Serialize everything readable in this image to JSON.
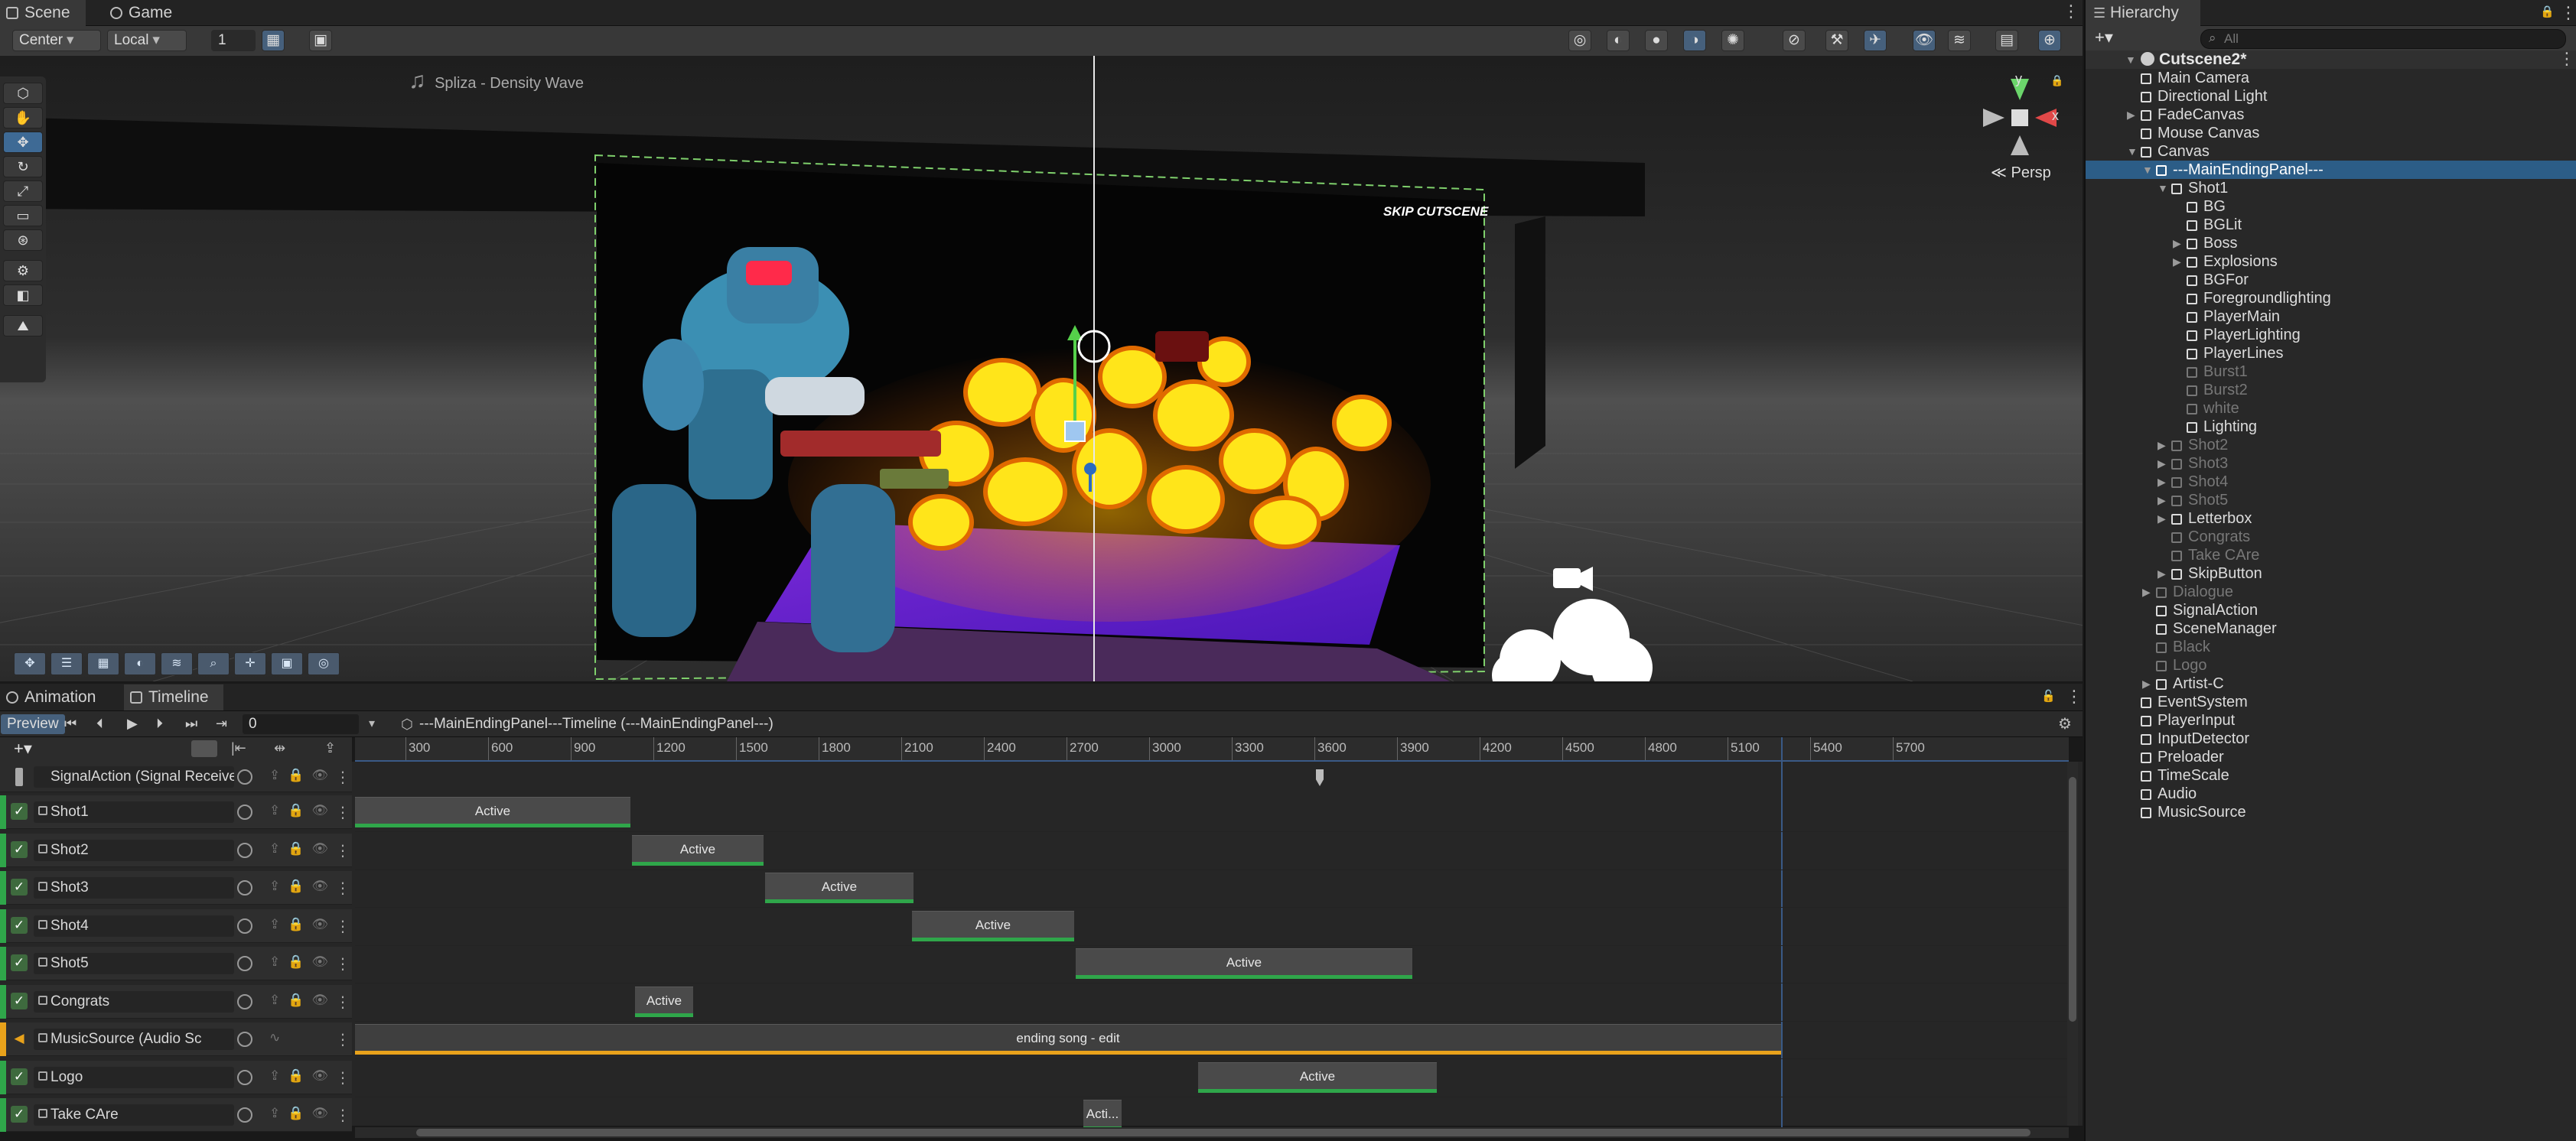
{
  "scene_tabs": {
    "scene": "Scene",
    "game": "Game"
  },
  "scene_toolbar": {
    "pivot": "Center",
    "space": "Local",
    "grid_value": "1"
  },
  "viewport": {
    "audio_label": "Spliza - Density Wave",
    "skip_label": "SKIP CUTSCENE",
    "gizmo": {
      "y": "y",
      "x": "x",
      "persp": "Persp"
    }
  },
  "timeline": {
    "tabs": {
      "animation": "Animation",
      "timeline": "Timeline"
    },
    "preview": "Preview",
    "frame": "0",
    "breadcrumb": "---MainEndingPanel---Timeline (---MainEndingPanel---)",
    "ruler": [
      "300",
      "600",
      "900",
      "1200",
      "1500",
      "1800",
      "2100",
      "2400",
      "2700",
      "3000",
      "3300",
      "3600",
      "3900",
      "4200",
      "4500",
      "4800",
      "5100",
      "5400",
      "5700"
    ],
    "signal_track": "SignalAction (Signal Receive",
    "tracks": [
      {
        "name": "Shot1",
        "clip": "Active"
      },
      {
        "name": "Shot2",
        "clip": "Active"
      },
      {
        "name": "Shot3",
        "clip": "Active"
      },
      {
        "name": "Shot4",
        "clip": "Active"
      },
      {
        "name": "Shot5",
        "clip": "Active"
      },
      {
        "name": "Congrats",
        "clip": "Active"
      },
      {
        "name": "MusicSource (Audio Sc",
        "clip": "ending song - edit"
      },
      {
        "name": "Logo",
        "clip": "Active"
      },
      {
        "name": "Take CAre",
        "clip": "Acti..."
      }
    ]
  },
  "hierarchy": {
    "title": "Hierarchy",
    "search_placeholder": "All",
    "root": "Cutscene2*",
    "items": [
      "Main Camera",
      "Directional Light",
      "FadeCanvas",
      "Mouse Canvas",
      "Canvas",
      "---MainEndingPanel---",
      "Shot1",
      "BG",
      "BGLit",
      "Boss",
      "Explosions",
      "BGFor",
      "Foregroundlighting",
      "PlayerMain",
      "PlayerLighting",
      "PlayerLines",
      "Burst1",
      "Burst2",
      "white",
      "Lighting",
      "Shot2",
      "Shot3",
      "Shot4",
      "Shot5",
      "Letterbox",
      "Congrats",
      "Take CAre",
      "SkipButton",
      "Dialogue",
      "SignalAction",
      "SceneManager",
      "Black",
      "Logo",
      "Artist-C",
      "EventSystem",
      "PlayerInput",
      "InputDetector",
      "Preloader",
      "TimeScale",
      "Audio",
      "MusicSource"
    ]
  },
  "colors": {
    "accent": "#3e6a95",
    "track_green": "#2fa64a",
    "audio_orange": "#e8a21b",
    "selection": "#2c5d87"
  }
}
